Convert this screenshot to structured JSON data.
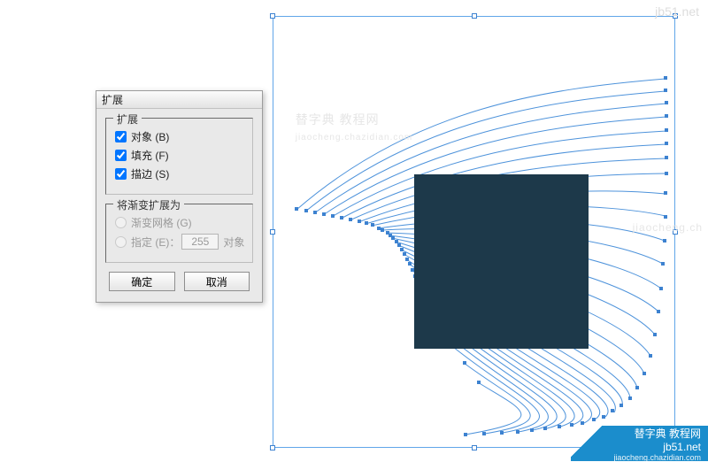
{
  "dialog": {
    "title": "扩展",
    "group_expand": {
      "legend": "扩展",
      "object_label": "对象 (B)",
      "object_checked": true,
      "fill_label": "填充 (F)",
      "fill_checked": true,
      "stroke_label": "描边 (S)",
      "stroke_checked": true
    },
    "group_gradient": {
      "legend": "将渐变扩展为",
      "mesh_label": "渐变网格 (G)",
      "spec_label": "指定 (E)：",
      "spec_value": "255",
      "spec_suffix": "对象"
    },
    "ok_label": "确定",
    "cancel_label": "取消"
  },
  "watermarks": {
    "top": "jb51.net",
    "mid": "替字典 教程网",
    "mid_url": "jiaocheng.chazidian.com",
    "side_url": "jiaocheng.ch"
  },
  "banner": {
    "site": "jb51.net",
    "site_cn": "替字典 教程网",
    "url": "jiaocheng.chazidian.com"
  }
}
